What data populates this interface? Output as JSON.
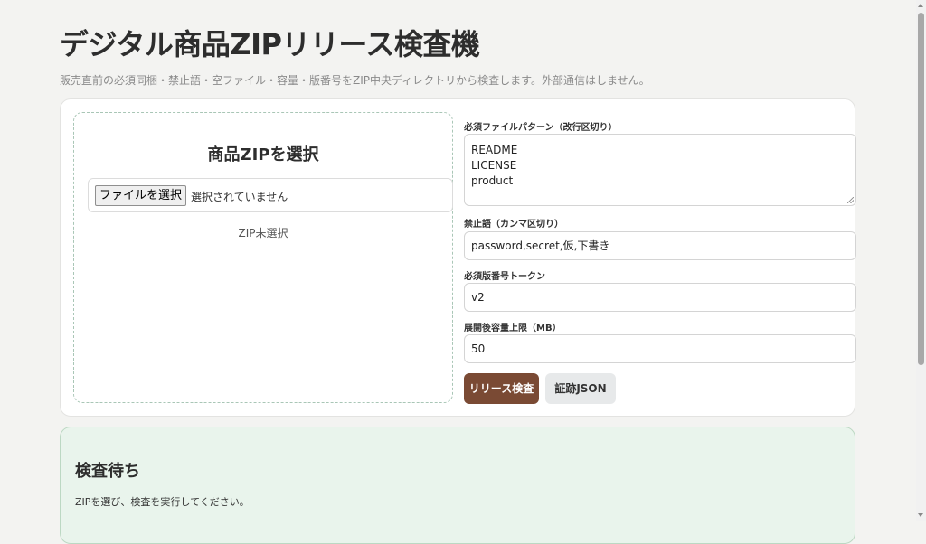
{
  "header": {
    "title": "デジタル商品ZIPリリース検査機",
    "subtitle": "販売直前の必須同梱・禁止語・空ファイル・容量・版番号をZIP中央ディレクトリから検査します。外部通信はしません。"
  },
  "dropzone": {
    "title": "商品ZIPを選択",
    "file_button": "ファイルを選択",
    "file_status": "選択されていません",
    "zip_state": "ZIP未選択"
  },
  "form": {
    "required_patterns": {
      "label": "必須ファイルパターン（改行区切り）",
      "lines": [
        "README",
        "LICENSE",
        "product"
      ]
    },
    "forbidden_words": {
      "label": "禁止語（カンマ区切り）",
      "value": "password,secret,仮,下書き"
    },
    "version_token": {
      "label": "必須版番号トークン",
      "value": "v2"
    },
    "max_size": {
      "label": "展開後容量上限（MB）",
      "value": "50"
    },
    "buttons": {
      "inspect": "リリース検査",
      "evidence": "証跡JSON"
    }
  },
  "status": {
    "title": "検査待ち",
    "message": "ZIPを選び、検査を実行してください。"
  },
  "colors": {
    "primary_button": "#7a4a34",
    "status_background": "#e9f4ec",
    "dropzone_border": "#a9c6b6"
  }
}
